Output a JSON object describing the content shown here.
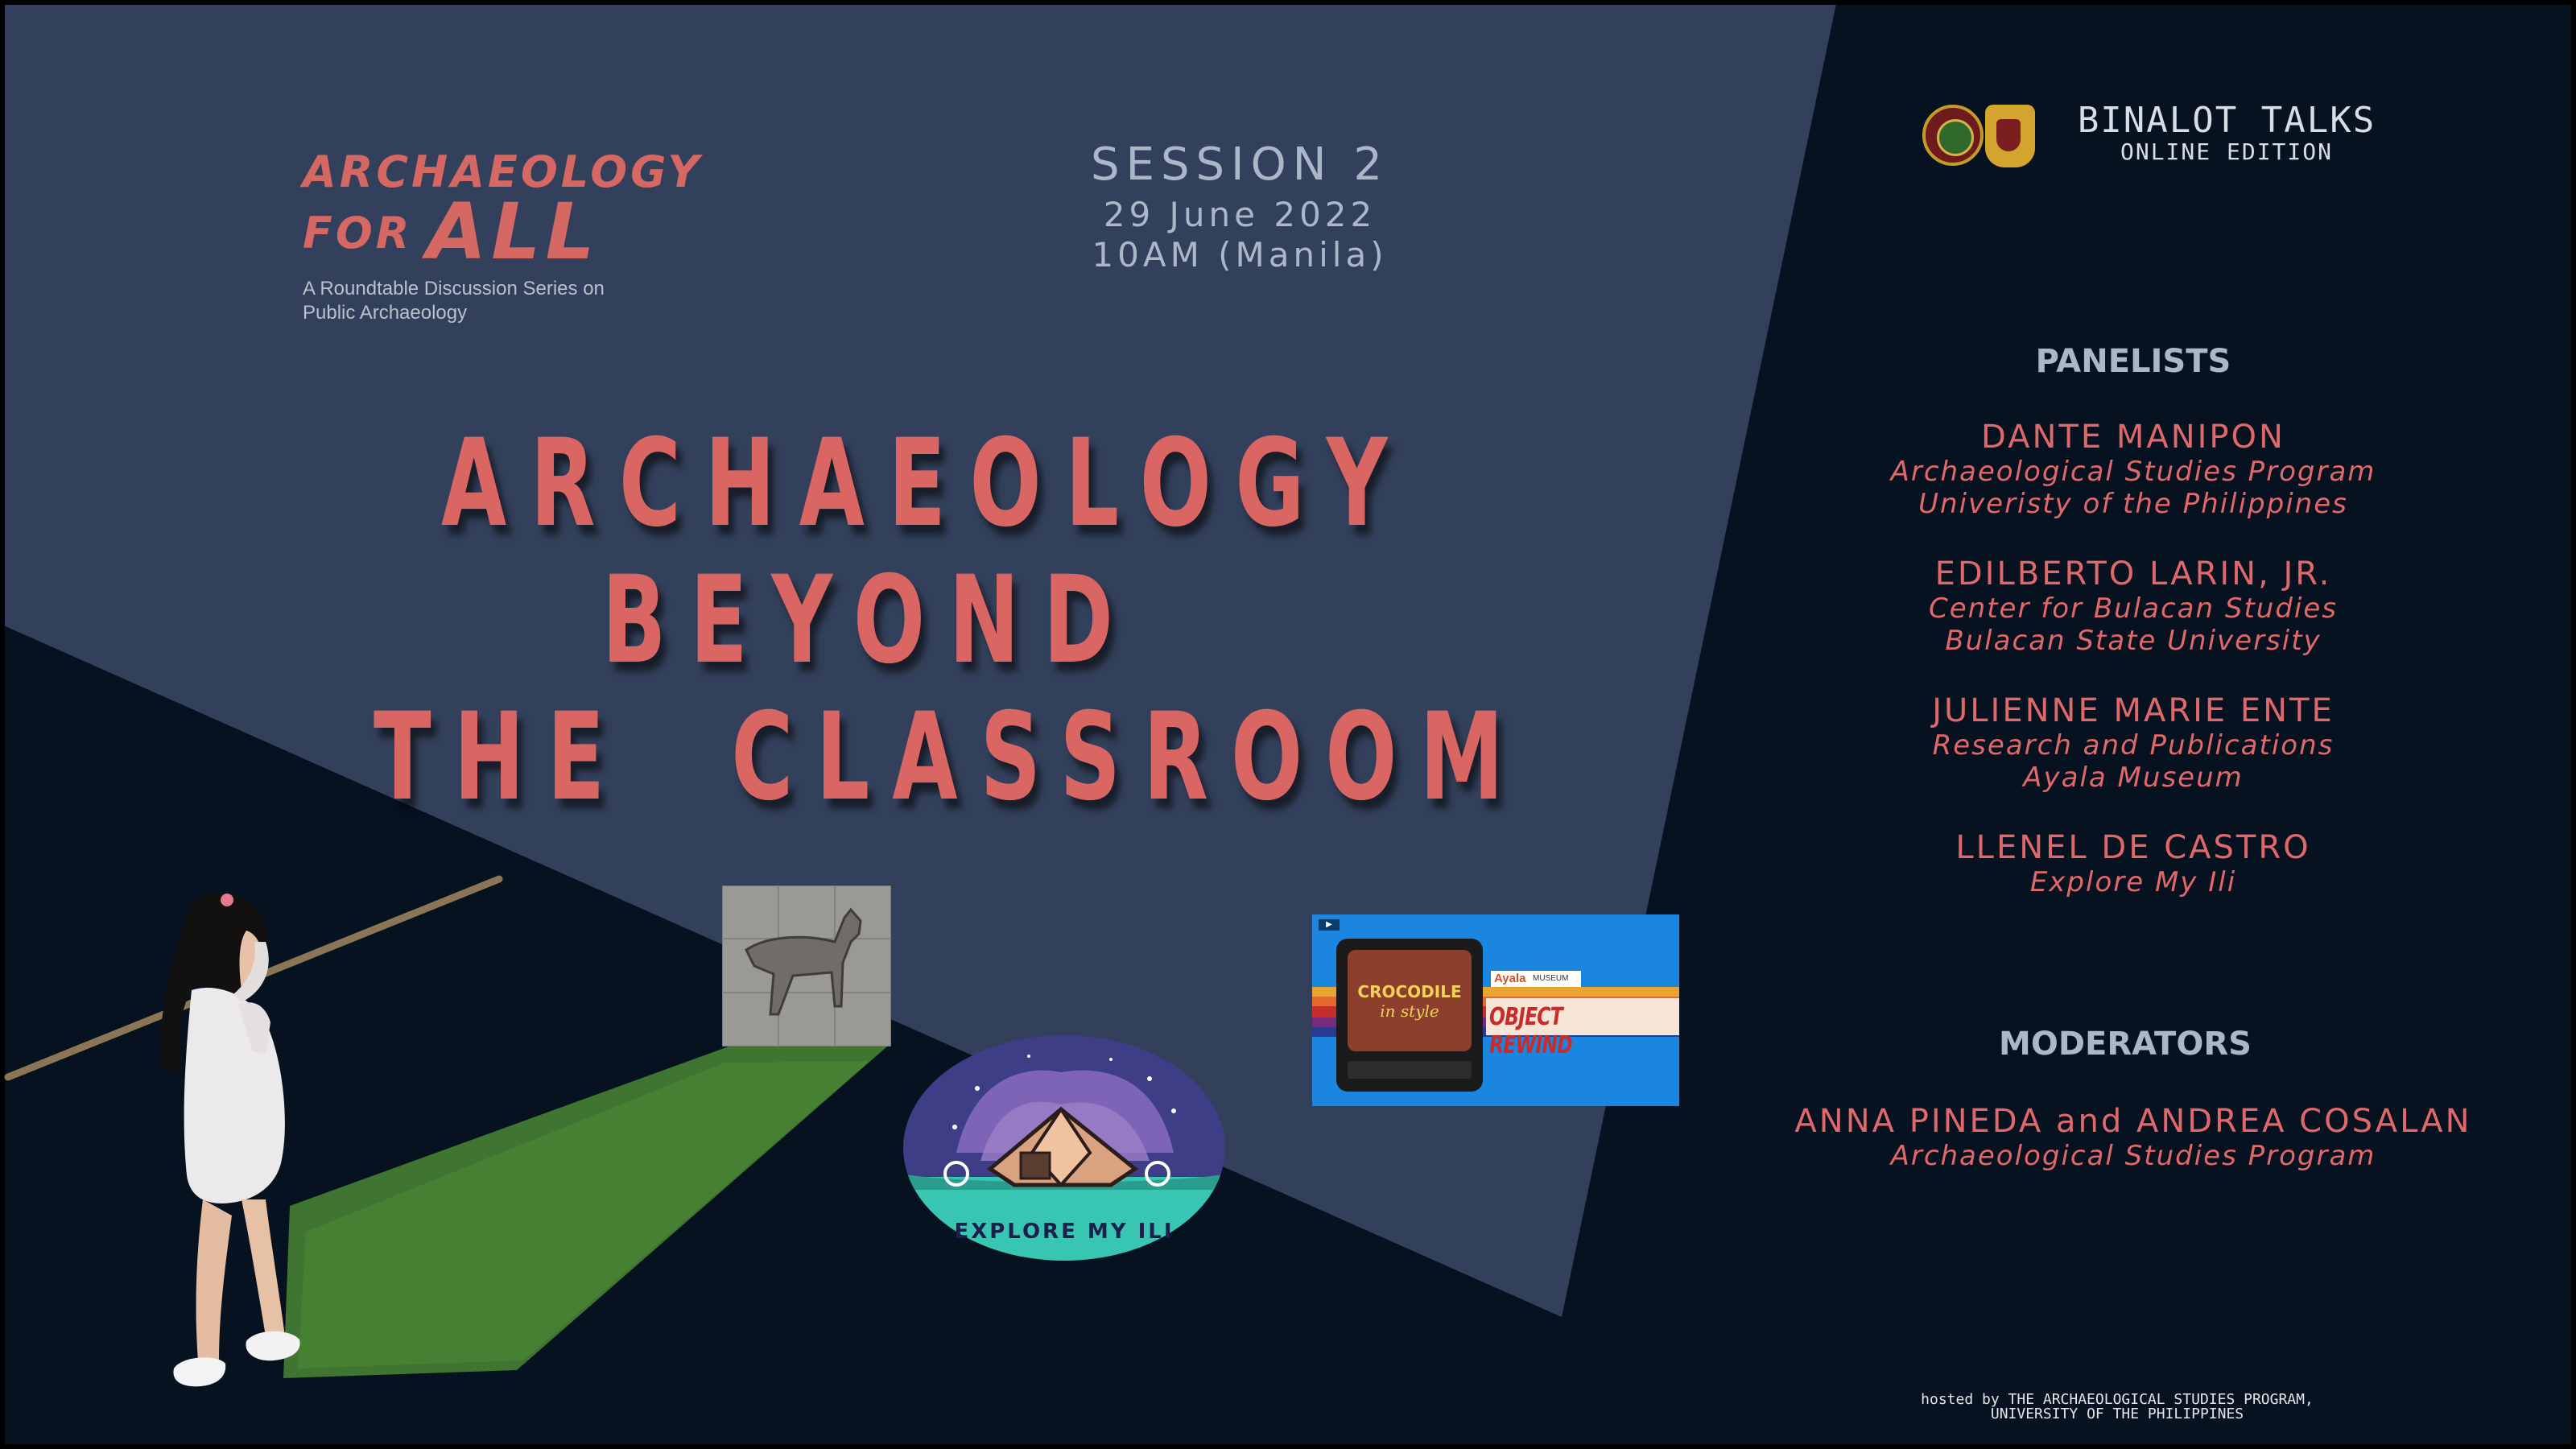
{
  "brand": {
    "line1": "ARCHAEOLOGY",
    "line2a": "FOR",
    "line2b": "ALL",
    "subtitle_line1": "A Roundtable Discussion Series on",
    "subtitle_line2": "Public Archaeology"
  },
  "session": {
    "label": "SESSION 2",
    "date": "29 June 2022",
    "time": "10AM (Manila)"
  },
  "headline": {
    "line1": "ARCHAEOLOGY",
    "line2": "BEYOND",
    "line3": "THE  CLASSROOM"
  },
  "binalot": {
    "title": "BINALOT TALKS",
    "subtitle": "ONLINE EDITION"
  },
  "panelists": {
    "heading": "PANELISTS",
    "items": [
      {
        "name": "DANTE MANIPON",
        "aff1": "Archaeological Studies Program",
        "aff2": "Univeristy of the Philippines"
      },
      {
        "name": "EDILBERTO LARIN, JR.",
        "aff1": "Center for Bulacan Studies",
        "aff2": "Bulacan State University"
      },
      {
        "name": "JULIENNE MARIE ENTE",
        "aff1": "Research and Publications",
        "aff2": "Ayala Museum"
      },
      {
        "name": "LLENEL DE CASTRO",
        "aff1": "Explore My Ili",
        "aff2": ""
      }
    ]
  },
  "moderators": {
    "heading": "MODERATORS",
    "name": "ANNA PINEDA and ANDREA COSALAN",
    "aff": "Archaeological Studies Program"
  },
  "ayala": {
    "tv_line1": "CROCODILE",
    "tv_line2": "in style",
    "brand_main": "Ayala",
    "brand_small": "MUSEUM",
    "banner": "OBJECT REWIND"
  },
  "explore_logo": {
    "text": "EXPLORE MY ILI"
  },
  "footer": {
    "line1": "hosted by THE ARCHAEOLOGICAL STUDIES PROGRAM,",
    "line2": "UNIVERSITY OF THE PHILIPPINES"
  },
  "colors": {
    "background_dark": "#07121f",
    "panel_blue": "#33405b",
    "accent_red": "#d96663",
    "muted_blue": "#a9b7c8"
  }
}
